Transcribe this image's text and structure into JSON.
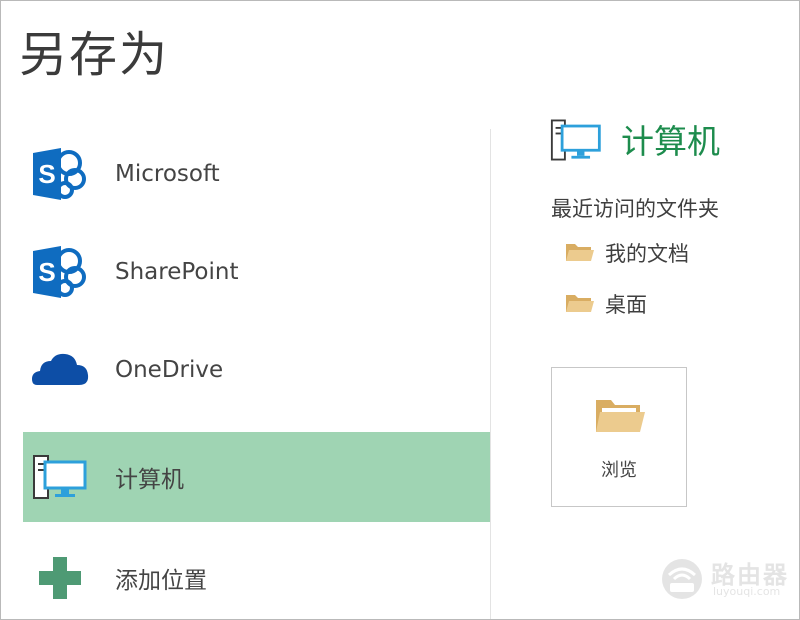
{
  "title": "另存为",
  "places": [
    {
      "label": "Microsoft",
      "icon": "sharepoint-icon"
    },
    {
      "label": "SharePoint",
      "icon": "sharepoint-icon"
    },
    {
      "label": "OneDrive",
      "icon": "onedrive-cloud-icon"
    },
    {
      "label": "计算机",
      "icon": "computer-icon",
      "selected": true
    },
    {
      "label": "添加位置",
      "icon": "plus-icon"
    }
  ],
  "location": {
    "title": "计算机",
    "icon": "computer-icon",
    "recent_heading": "最近访问的文件夹",
    "folders": [
      {
        "label": "我的文档",
        "icon": "folder-icon"
      },
      {
        "label": "桌面",
        "icon": "folder-icon"
      }
    ],
    "browse_label": "浏览"
  },
  "watermark": {
    "text": "路由器",
    "url": "luyouqi.com"
  },
  "colors": {
    "selected_background": "#9fd4b3",
    "accent_green": "#1d8c4d",
    "sharepoint_blue": "#0f6cc0",
    "onedrive_blue": "#0d4ea6",
    "plus_green": "#4e9a74",
    "folder_tan": "#e9c585",
    "monitor_blue": "#2da0db"
  }
}
